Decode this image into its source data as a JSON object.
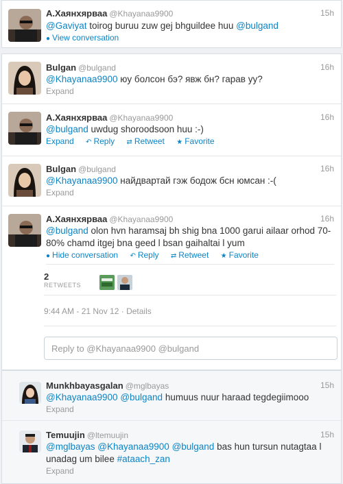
{
  "tweets": [
    {
      "name": "А.Хаянхярваа",
      "handle": "@Khayanaa9900",
      "time": "15h",
      "mention1": "@Gaviyat",
      "text": " toirog buruu zuw gej bhguildee huu ",
      "mention2": "@bulgand",
      "action": "View conversation"
    },
    {
      "name": "Bulgan",
      "handle": "@bulgand",
      "time": "16h",
      "mention1": "@Khayanaa9900",
      "text": " юу болсон бэ? явж бн? гарав уу?",
      "action": "Expand"
    },
    {
      "name": "А.Хаянхярваа",
      "handle": "@Khayanaa9900",
      "time": "16h",
      "mention1": "@bulgand",
      "text": " uwdug shoroodsoon huu :-)",
      "expand": "Expand",
      "reply": "Reply",
      "retweet": "Retweet",
      "favorite": "Favorite"
    },
    {
      "name": "Bulgan",
      "handle": "@bulgand",
      "time": "16h",
      "mention1": "@Khayanaa9900",
      "text": " найдвартай гэж бодож бсн юмсан :-(",
      "action": "Expand"
    },
    {
      "name": "А.Хаянхярваа",
      "handle": "@Khayanaa9900",
      "time": "16h",
      "mention1": "@bulgand",
      "text": " olon hvn haramsaj bh shig bna 1000 garui ailaar orhod 70-80% chamd itgej bna geed l bsan gaihaltai l yum",
      "hide": "Hide conversation",
      "reply": "Reply",
      "retweet": "Retweet",
      "favorite": "Favorite",
      "retweet_count": "2",
      "retweet_label": "RETWEETS",
      "timestamp": "9:44 AM - 21 Nov 12",
      "details": "Details"
    }
  ],
  "reply_box": {
    "placeholder": "Reply to @Khayanaa9900 @bulgand"
  },
  "replies": [
    {
      "name": "Munkhbayasgalan",
      "handle": "@mglbayas",
      "time": "15h",
      "m1": "@Khayanaa9900",
      "m2": "@bulgand",
      "text": " humuus nuur haraad tegdegiimooo",
      "expand": "Expand"
    },
    {
      "name": "Temuujin",
      "handle": "@ltemuujin",
      "time": "15h",
      "m1": "@mglbayas",
      "m2": "@Khayanaa9900",
      "m3": "@bulgand",
      "text": " bas hun tursun nutagtaa l unadag um bilee ",
      "hashtag": "#ataach_zan",
      "expand": "Expand"
    }
  ],
  "icons": {
    "bubble": "speech-bubble-icon",
    "reply": "reply-arrow-icon",
    "retweet": "retweet-icon",
    "favorite": "star-icon"
  },
  "colors": {
    "link": "#0b84c6",
    "meta": "#999999",
    "text": "#333333"
  }
}
